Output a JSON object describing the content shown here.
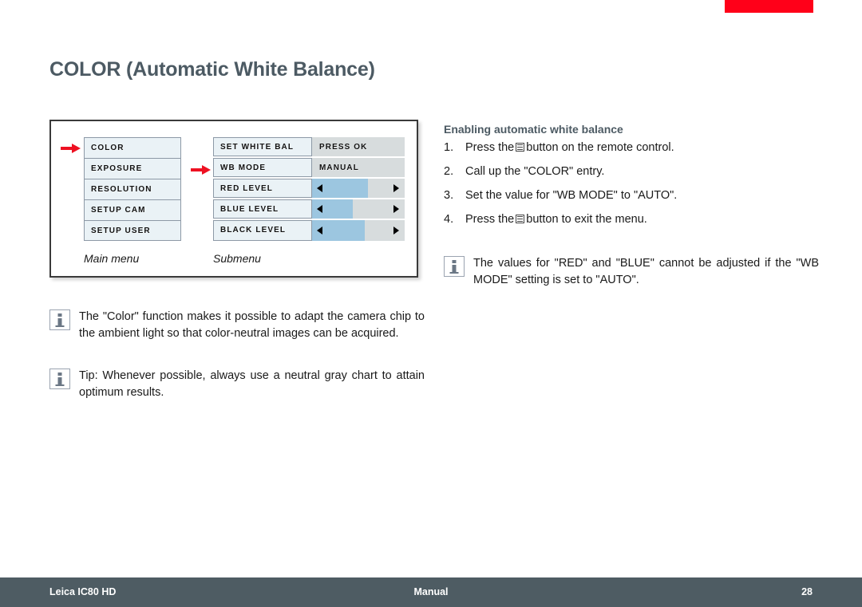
{
  "document": {
    "title": "COLOR (Automatic White Balance)",
    "accent_red": "#ff0019",
    "heading_color": "#4c5a63",
    "footer_color": "#4e5c63"
  },
  "diagram": {
    "main_menu": {
      "caption": "Main menu",
      "items": [
        "COLOR",
        "EXPOSURE",
        "RESOLUTION",
        "SETUP CAM",
        "SETUP USER"
      ]
    },
    "submenu": {
      "caption": "Submenu",
      "rows": [
        {
          "label": "SET WHITE BAL",
          "type": "value",
          "value": "PRESS OK"
        },
        {
          "label": "WB MODE",
          "type": "value",
          "value": "MANUAL"
        },
        {
          "label": "RED LEVEL",
          "type": "slider",
          "fill_percent": 60
        },
        {
          "label": "BLUE LEVEL",
          "type": "slider",
          "fill_percent": 44
        },
        {
          "label": "BLACK LEVEL",
          "type": "slider",
          "fill_percent": 57
        }
      ],
      "slider_fill_color": "#9cc6e0",
      "slider_track_color": "#d7dcdd"
    }
  },
  "notes": {
    "color_function": "The \"Color\" function makes it possible to adapt the camera chip to the ambient light so that color-neutral images can be acquired.",
    "tip": "Tip: Whenever possible, always use a neutral gray chart to attain optimum results.",
    "red_blue_warning": "The values for \"RED\" and \"BLUE\" cannot be adjusted if the \"WB MODE\" setting is set to \"AUTO\"."
  },
  "procedure": {
    "heading": "Enabling automatic white balance",
    "steps": [
      {
        "num": "1.",
        "before": "Press the",
        "glyph": "menu-button-icon",
        "after": "button on the remote control."
      },
      {
        "num": "2.",
        "before": "Call up the \"COLOR\" entry.",
        "glyph": null,
        "after": ""
      },
      {
        "num": "3.",
        "before": "Set the value for \"WB MODE\" to \"AUTO\".",
        "glyph": null,
        "after": ""
      },
      {
        "num": "4.",
        "before": "Press the",
        "glyph": "menu-button-icon",
        "after": "button to exit the menu."
      }
    ]
  },
  "footer": {
    "left": "Leica IC80 HD",
    "center": "Manual",
    "page": "28"
  }
}
